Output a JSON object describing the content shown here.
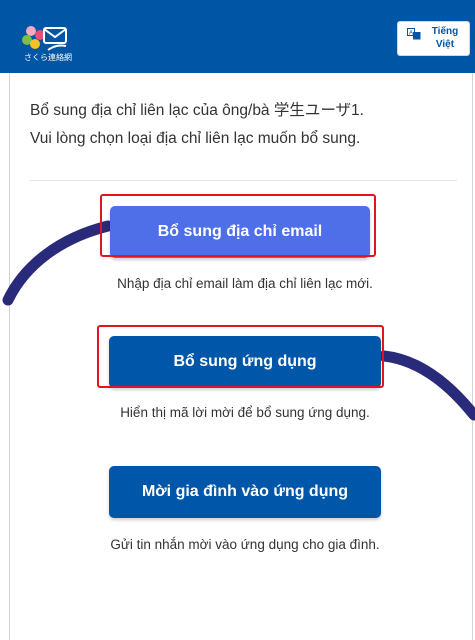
{
  "header": {
    "logo_text": "さくら連絡網",
    "language_button": {
      "line1": "Tiếng",
      "line2": "Việt"
    }
  },
  "intro": {
    "line1": "Bổ sung địa chỉ liên lạc của ông/bà 学生ユーザ1.",
    "line2": "Vui lòng chọn loại địa chỉ liên lạc muốn bổ sung."
  },
  "options": [
    {
      "label": "Bổ sung địa chỉ email",
      "description": "Nhập địa chỉ email làm địa chỉ liên lạc mới."
    },
    {
      "label": "Bổ sung ứng dụng",
      "description": "Hiển thị mã lời mời để bổ sung ứng dụng."
    },
    {
      "label": "Mời gia đình vào ứng dụng",
      "description": "Gửi tin nhắn mời vào ứng dụng cho gia đình."
    }
  ],
  "colors": {
    "header_bg": "#0055a5",
    "primary_button": "#0056a8",
    "email_button": "#4f6fe8",
    "highlight_box": "#e2141e",
    "annotation_curve": "#2a2a7a"
  }
}
